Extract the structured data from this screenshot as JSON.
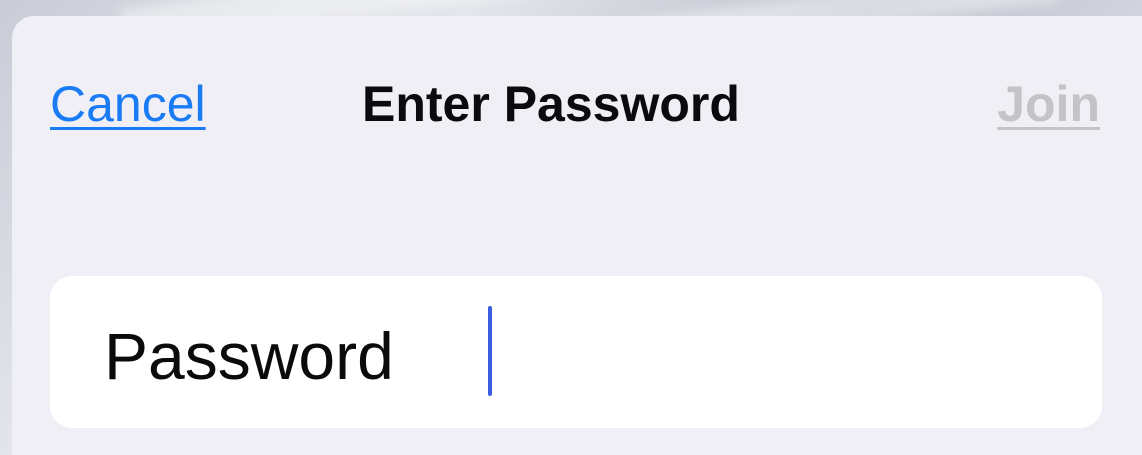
{
  "nav": {
    "cancel_label": "Cancel",
    "title": "Enter Password",
    "join_label": "Join"
  },
  "password_field": {
    "label": "Password",
    "value": "",
    "placeholder": ""
  },
  "colors": {
    "accent": "#1a7cf5",
    "disabled": "#c4c4c8",
    "sheet_background": "#f0eff5",
    "field_background": "#ffffff",
    "caret": "#3a5fe0"
  }
}
